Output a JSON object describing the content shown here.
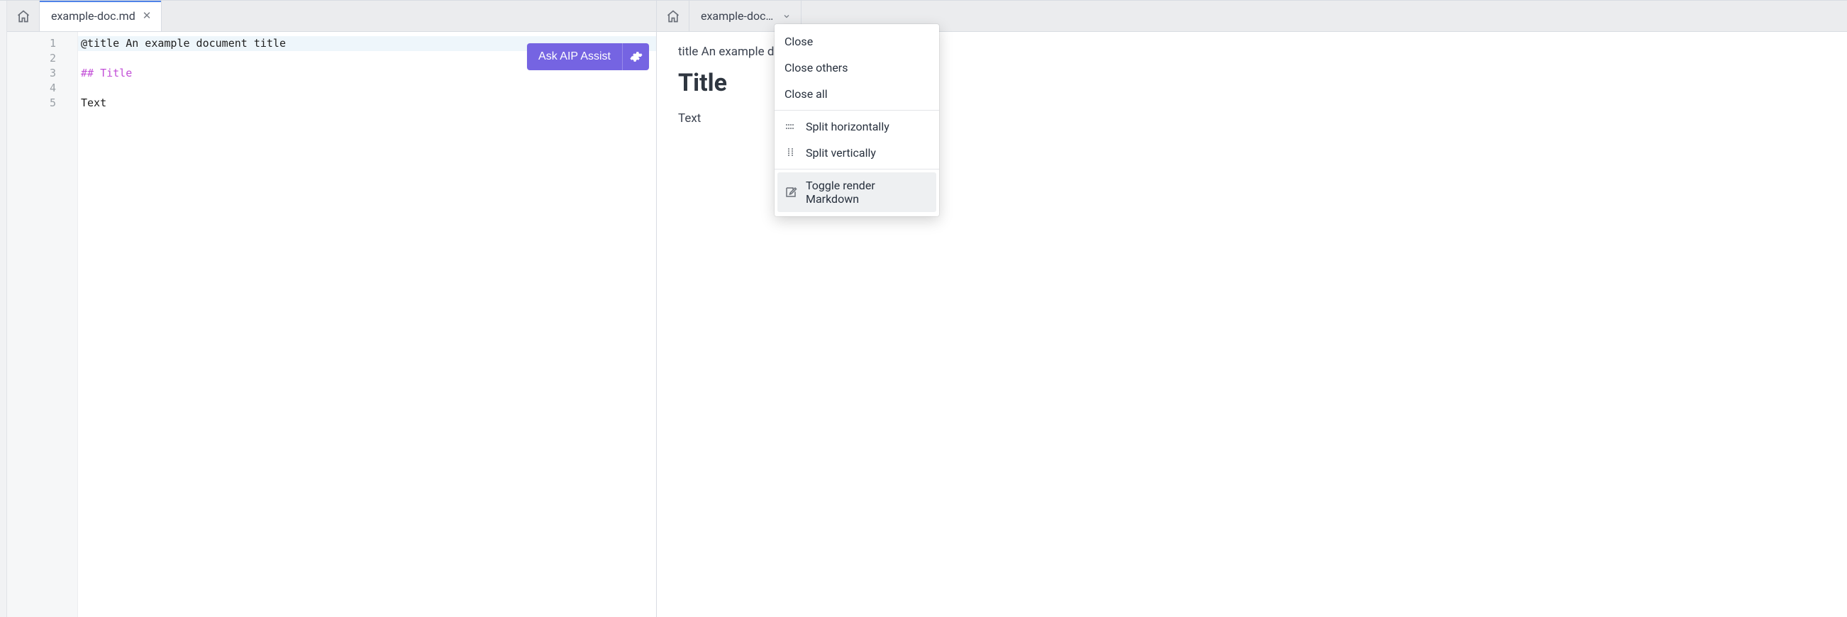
{
  "left": {
    "tab": {
      "label": "example-doc.md",
      "active": true
    },
    "editor": {
      "lines": [
        {
          "n": "1",
          "raw": "@title An example document title",
          "type": "plain",
          "highlight": true
        },
        {
          "n": "2",
          "raw": "",
          "type": "plain"
        },
        {
          "n": "3",
          "raw": "## Title",
          "type": "header"
        },
        {
          "n": "4",
          "raw": "",
          "type": "plain"
        },
        {
          "n": "5",
          "raw": "Text",
          "type": "plain"
        }
      ]
    },
    "assist": {
      "label": "Ask AIP Assist"
    }
  },
  "right": {
    "tab": {
      "label": "example-doc.md"
    },
    "preview": {
      "title_line": "title An example document title",
      "heading": "Title",
      "body": "Text"
    }
  },
  "context_menu": {
    "items": [
      {
        "label": "Close",
        "icon": null
      },
      {
        "label": "Close others",
        "icon": null
      },
      {
        "label": "Close all",
        "icon": null
      }
    ],
    "items2": [
      {
        "label": "Split horizontally",
        "icon": "split-h"
      },
      {
        "label": "Split vertically",
        "icon": "split-v"
      }
    ],
    "items3": [
      {
        "label": "Toggle render Markdown",
        "icon": "edit-box",
        "hover": true
      }
    ]
  }
}
